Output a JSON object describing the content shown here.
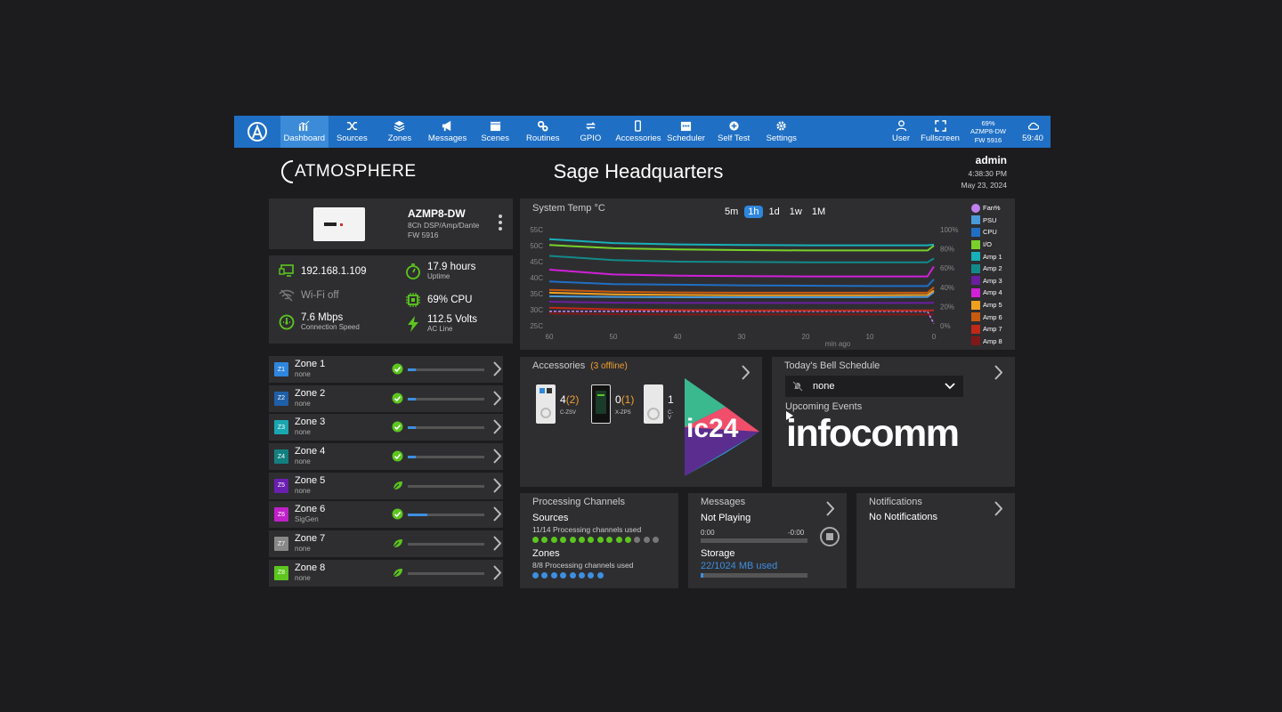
{
  "nav": {
    "items": [
      {
        "label": "Dashboard",
        "icon": "chart-icon"
      },
      {
        "label": "Sources",
        "icon": "shuffle-icon"
      },
      {
        "label": "Zones",
        "icon": "layers-icon"
      },
      {
        "label": "Messages",
        "icon": "megaphone-icon"
      },
      {
        "label": "Scenes",
        "icon": "clapperboard-icon"
      },
      {
        "label": "Routines",
        "icon": "gears-icon"
      },
      {
        "label": "GPIO",
        "icon": "arrows-icon"
      },
      {
        "label": "Accessories",
        "icon": "phone-icon"
      },
      {
        "label": "Scheduler",
        "icon": "calendar-icon"
      },
      {
        "label": "Self Test",
        "icon": "bandage-icon"
      },
      {
        "label": "Settings",
        "icon": "gear-icon"
      }
    ],
    "user": "User",
    "fullscreen": "Fullscreen",
    "device_pct": "69%",
    "device_name": "AZMP8-DW",
    "device_fw": "FW 5916",
    "cloud_time": "59:40",
    "accent": "#1f6fc5"
  },
  "header": {
    "brand": "ATMOSPHERE",
    "title": "Sage Headquarters",
    "user": "admin",
    "time": "4:38:30 PM",
    "date": "May 23, 2024"
  },
  "device": {
    "name": "AZMP8-DW",
    "desc": "8Ch DSP/Amp/Dante",
    "fw": "FW 5916"
  },
  "status": {
    "ip": "192.168.1.109",
    "wifi": "Wi-Fi off",
    "speed": "7.6 Mbps",
    "speed_label": "Connection Speed",
    "uptime": "17.9 hours",
    "uptime_label": "Uptime",
    "cpu": "69% CPU",
    "volts": "112.5 Volts",
    "volts_label": "AC Line"
  },
  "zones": [
    {
      "badge": "Z1",
      "name": "Zone 1",
      "source": "none",
      "color": "#2e86de",
      "state": "check",
      "level": 0.1
    },
    {
      "badge": "Z2",
      "name": "Zone 2",
      "source": "none",
      "color": "#1f5fa8",
      "state": "check",
      "level": 0.1
    },
    {
      "badge": "Z3",
      "name": "Zone 3",
      "source": "none",
      "color": "#1aa6b0",
      "state": "check",
      "level": 0.1
    },
    {
      "badge": "Z4",
      "name": "Zone 4",
      "source": "none",
      "color": "#138080",
      "state": "check",
      "level": 0.1
    },
    {
      "badge": "Z5",
      "name": "Zone 5",
      "source": "none",
      "color": "#6a1fb0",
      "state": "leaf",
      "level": 0
    },
    {
      "badge": "Z6",
      "name": "Zone 6",
      "source": "SigGen",
      "color": "#c020c8",
      "state": "check",
      "level": 0.25
    },
    {
      "badge": "Z7",
      "name": "Zone 7",
      "source": "none",
      "color": "#888888",
      "state": "leaf",
      "level": 0
    },
    {
      "badge": "Z8",
      "name": "Zone 8",
      "source": "none",
      "color": "#5cc61e",
      "state": "leaf",
      "level": 0
    }
  ],
  "chart_data": {
    "type": "line",
    "title": "System Temp °C",
    "ranges": [
      "5m",
      "1h",
      "1d",
      "1w",
      "1M"
    ],
    "selected_range": "1h",
    "xlabel": "min ago",
    "x_ticks": [
      "60",
      "50",
      "40",
      "30",
      "20",
      "10",
      "0"
    ],
    "y_ticks": [
      "55C",
      "50C",
      "45C",
      "40C",
      "35C",
      "30C",
      "25C"
    ],
    "y2_ticks": [
      "100%",
      "80%",
      "60%",
      "40%",
      "20%",
      "0%"
    ],
    "ylim": [
      25,
      55
    ],
    "y2lim": [
      0,
      100
    ],
    "x": [
      60,
      50,
      40,
      30,
      20,
      10,
      1,
      0
    ],
    "series": [
      {
        "name": "Fan%",
        "color": "#c080f0",
        "axis": "pct",
        "dashed": true,
        "values": [
          15,
          15,
          15,
          15,
          15,
          15,
          15,
          2
        ]
      },
      {
        "name": "PSU",
        "color": "#4a9ad8",
        "values": [
          34.2,
          34,
          33.9,
          33.9,
          33.9,
          33.9,
          34,
          35.5
        ]
      },
      {
        "name": "CPU",
        "color": "#1f6fc5",
        "values": [
          38.8,
          38,
          37.8,
          37.6,
          37.5,
          37.4,
          37.4,
          39.5
        ]
      },
      {
        "name": "I/O",
        "color": "#7ad02a",
        "values": [
          50.2,
          49.2,
          48.8,
          48.6,
          48.5,
          48.5,
          48.5,
          50
        ]
      },
      {
        "name": "Amp 1",
        "color": "#18b0b8",
        "values": [
          52,
          50.8,
          50.4,
          50.2,
          50.1,
          50.1,
          50.1,
          50.3
        ]
      },
      {
        "name": "Amp 2",
        "color": "#138a8a",
        "values": [
          46.8,
          45.5,
          45,
          44.9,
          44.8,
          44.8,
          44.8,
          46
        ]
      },
      {
        "name": "Amp 3",
        "color": "#6a1f9f",
        "values": [
          32.5,
          32.2,
          32.1,
          32.1,
          32.1,
          32.1,
          32.1,
          32.2
        ]
      },
      {
        "name": "Amp 4",
        "color": "#d020d8",
        "values": [
          42.5,
          41,
          40.6,
          40.5,
          40.4,
          40.4,
          40.4,
          43.5
        ]
      },
      {
        "name": "Amp 5",
        "color": "#f0a020",
        "values": [
          35.3,
          34.8,
          34.6,
          34.5,
          34.5,
          34.5,
          34.6,
          36
        ]
      },
      {
        "name": "Amp 6",
        "color": "#c85a10",
        "values": [
          36.2,
          35.6,
          35.4,
          35.3,
          35.3,
          35.3,
          35.3,
          37
        ]
      },
      {
        "name": "Amp 7",
        "color": "#c02818",
        "values": [
          30.6,
          30.1,
          29.9,
          29.8,
          29.8,
          29.8,
          29.8,
          29.8
        ]
      },
      {
        "name": "Amp 8",
        "color": "#801818",
        "values": [
          28.8,
          28.6,
          28.5,
          28.5,
          28.5,
          28.5,
          28.5,
          28.5
        ]
      }
    ]
  },
  "accessories": {
    "title": "Accessories",
    "offline": "(3 offline)",
    "items": [
      {
        "count": "4",
        "offline": "(2)",
        "label": "C-ZSV"
      },
      {
        "count": "0",
        "offline": "(1)",
        "label": "X-ZPS"
      },
      {
        "count": "1",
        "offline": "",
        "label": "C-V"
      }
    ],
    "logo_text": "ic24"
  },
  "bell": {
    "title": "Today's Bell Schedule",
    "selected": "none",
    "upcoming": "Upcoming Events",
    "banner": "infocomm"
  },
  "processing": {
    "title": "Processing Channels",
    "sources": "Sources",
    "sources_used": "11/14 Processing channels used",
    "sources_used_n": 11,
    "sources_total_n": 14,
    "zones": "Zones",
    "zones_used": "8/8 Processing channels used",
    "zones_used_n": 8,
    "zones_total_n": 8
  },
  "messages": {
    "title": "Messages",
    "status": "Not Playing",
    "time_start": "0:00",
    "time_end": "-0:00",
    "storage": "Storage",
    "storage_used": "22/1024 MB used",
    "storage_fraction": 0.021
  },
  "notifications": {
    "title": "Notifications",
    "text": "No Notifications"
  }
}
